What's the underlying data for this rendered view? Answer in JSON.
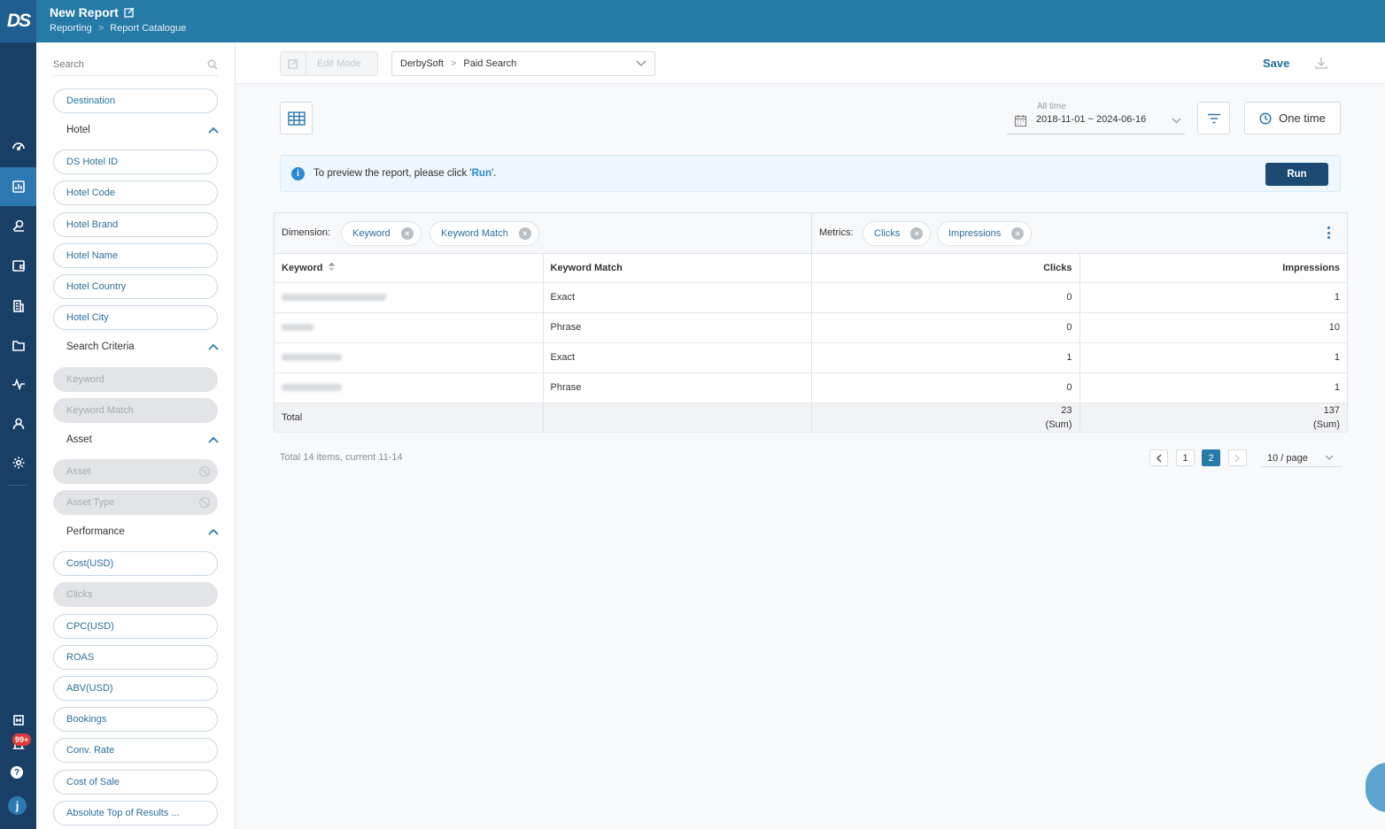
{
  "app": {
    "logo": "DS"
  },
  "header": {
    "title": "New Report",
    "breadcrumb": [
      "Reporting",
      "Report Catalogue"
    ],
    "breadcrumb_sep": ">"
  },
  "rail": {
    "items": [
      "dashboard-icon",
      "report-icon",
      "search-tool-icon",
      "wallet-icon",
      "building-icon",
      "folder-icon",
      "activity-icon",
      "user-icon",
      "settings-icon"
    ],
    "notification_badge": "99+",
    "help": "?",
    "user_initial": "j"
  },
  "sidebar": {
    "search_placeholder": "Search",
    "top_pill": "Destination",
    "groups": {
      "hotel": {
        "label": "Hotel",
        "items": [
          "DS Hotel ID",
          "Hotel Code",
          "Hotel Brand",
          "Hotel Name",
          "Hotel Country",
          "Hotel City"
        ]
      },
      "search_criteria": {
        "label": "Search Criteria",
        "items": [
          "Keyword",
          "Keyword Match"
        ]
      },
      "asset": {
        "label": "Asset",
        "items": [
          "Asset",
          "Asset Type"
        ]
      },
      "performance": {
        "label": "Performance",
        "items": [
          "Cost(USD)",
          "Clicks",
          "CPC(USD)",
          "ROAS",
          "ABV(USD)",
          "Bookings",
          "Conv. Rate",
          "Cost of Sale",
          "Absolute Top of Results ..."
        ]
      }
    }
  },
  "toolbar": {
    "edit_mode": "Edit Mode",
    "datasource": {
      "account": "DerbySoft",
      "sep": ">",
      "source": "Paid Search"
    },
    "save": "Save"
  },
  "controls": {
    "date_label": "All time",
    "date_range": "2018-11-01 ~ 2024-06-16",
    "schedule": "One time"
  },
  "info": {
    "message_prefix": "To preview the report, please click '",
    "message_link": "Run",
    "message_suffix": "'.",
    "run_button": "Run"
  },
  "table": {
    "dimension_label": "Dimension:",
    "dimensions": [
      "Keyword",
      "Keyword Match"
    ],
    "metrics_label": "Metrics:",
    "metrics": [
      "Clicks",
      "Impressions"
    ],
    "columns": [
      "Keyword",
      "Keyword Match",
      "Clicks",
      "Impressions"
    ],
    "rows": [
      {
        "match": "Exact",
        "clicks": "0",
        "impressions": "1"
      },
      {
        "match": "Phrase",
        "clicks": "0",
        "impressions": "10"
      },
      {
        "match": "Exact",
        "clicks": "1",
        "impressions": "1"
      },
      {
        "match": "Phrase",
        "clicks": "0",
        "impressions": "1"
      }
    ],
    "total": {
      "label": "Total",
      "clicks": "23",
      "impressions": "137",
      "agg": "(Sum)"
    }
  },
  "pagination": {
    "summary": "Total 14 items, current 11-14",
    "pages": [
      "1",
      "2"
    ],
    "current": "2",
    "page_size": "10 / page"
  },
  "colors": {
    "header": "#267aa6",
    "rail": "#1a3f66",
    "accent": "#2c78b0",
    "run": "#1b4a73"
  }
}
